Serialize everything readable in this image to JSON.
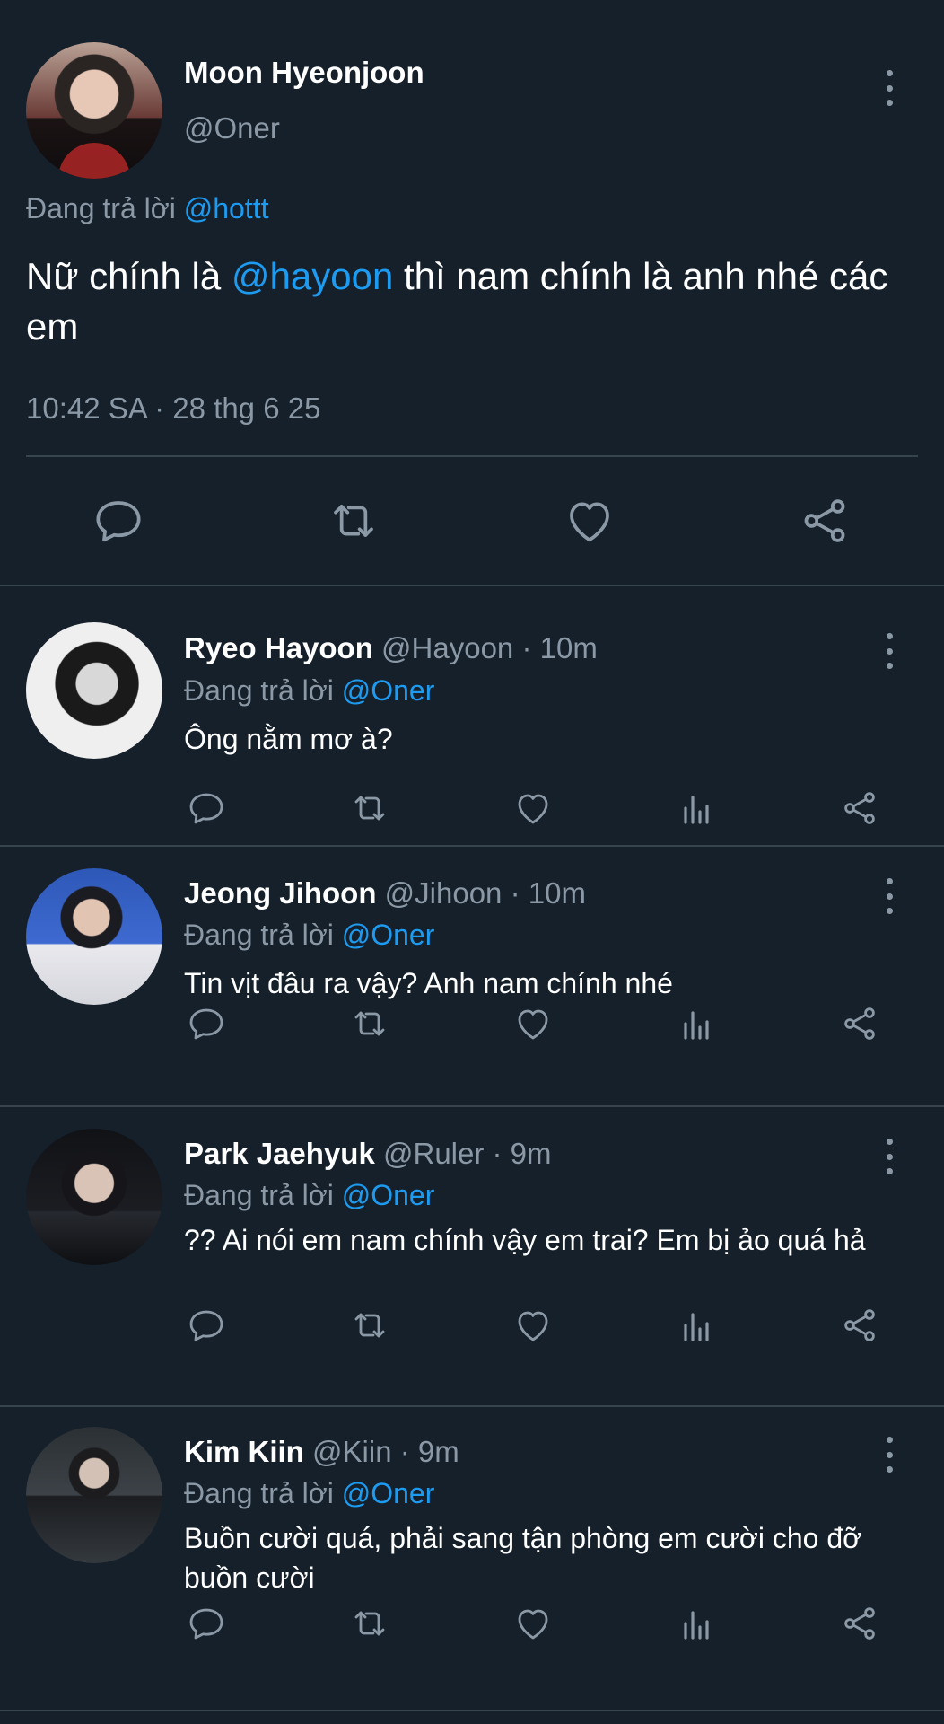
{
  "main_tweet": {
    "name": "Moon Hyeonjoon",
    "handle": "@Oner",
    "replying_prefix": "Đang trả lời",
    "replying_to": "@hottt",
    "text_before": "Nữ chính là ",
    "text_mention": "@hayoon",
    "text_after": " thì nam chính là anh nhé các em",
    "timestamp": "10:42 SA · 28 thg 6 25"
  },
  "replies": [
    {
      "name": "Ryeo Hayoon",
      "handle": "@Hayoon",
      "time": "· 10m",
      "replying_prefix": "Đang trả lời",
      "replying_to": "@Oner",
      "text": "Ông nằm mơ à?"
    },
    {
      "name": "Jeong Jihoon",
      "handle": "@Jihoon",
      "time": "· 10m",
      "replying_prefix": "Đang trả lời",
      "replying_to": "@Oner",
      "text": "Tin vịt đâu ra vậy? Anh nam chính nhé"
    },
    {
      "name": "Park Jaehyuk",
      "handle": "@Ruler",
      "time": "· 9m",
      "replying_prefix": "Đang trả lời",
      "replying_to": "@Oner",
      "text": "?? Ai nói em nam chính vậy em trai? Em bị ảo quá hả"
    },
    {
      "name": "Kim Kiin",
      "handle": "@Kiin",
      "time": "· 9m",
      "replying_prefix": "Đang trả lời",
      "replying_to": "@Oner",
      "text": "Buồn cười quá, phải sang tận phòng em cười cho đỡ buồn cười"
    }
  ],
  "icons": {
    "reply": "reply-icon",
    "retweet": "retweet-icon",
    "like": "heart-icon",
    "analytics": "analytics-icon",
    "share": "share-icon",
    "more": "more-vertical-icon"
  },
  "colors": {
    "background": "#15202b",
    "divider": "#38444d",
    "secondary_text": "#8b98a5",
    "mention": "#1d9bf0"
  }
}
